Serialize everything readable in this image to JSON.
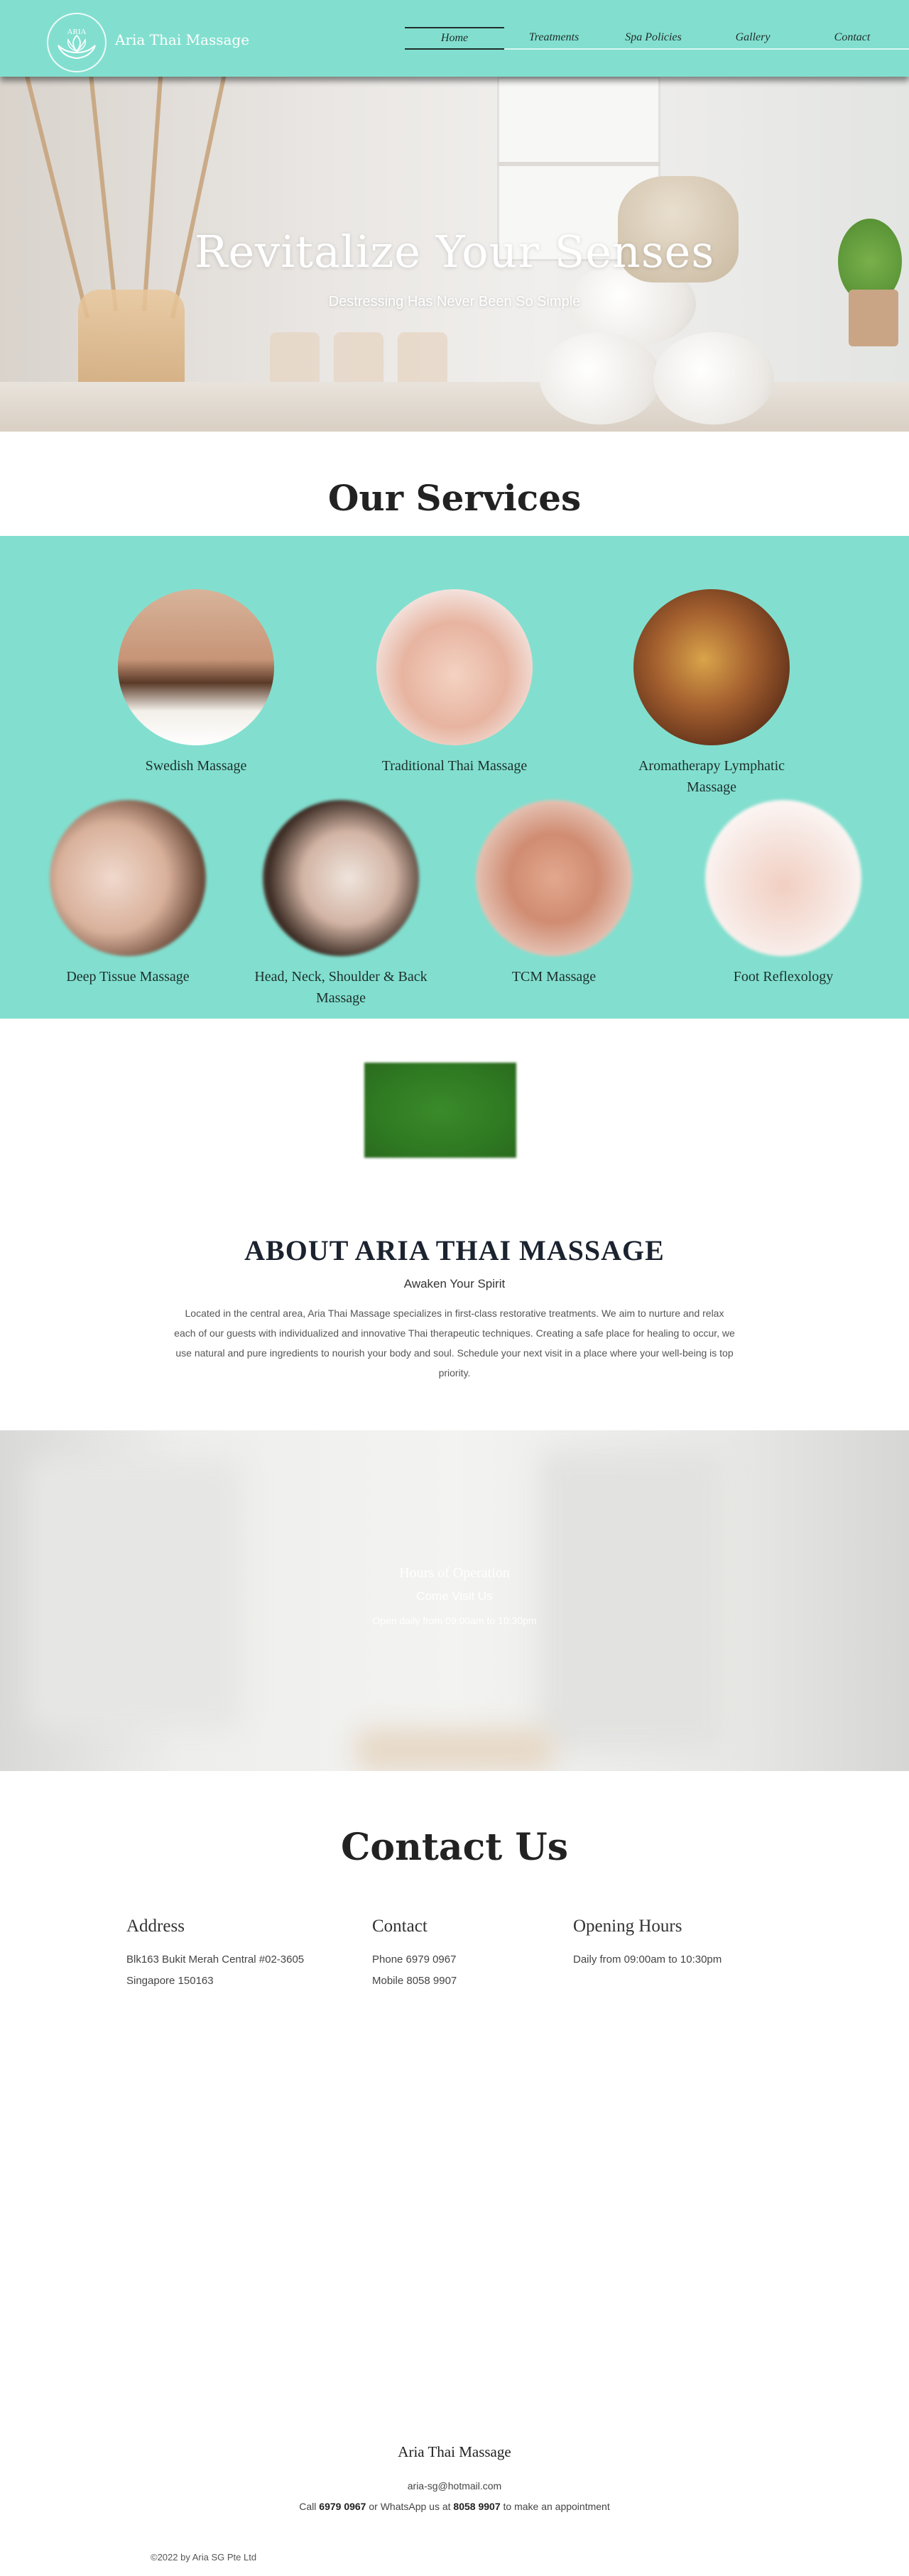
{
  "header": {
    "brand": "Aria Thai Massage",
    "logo_text": "ARIA",
    "bg_color": "#82dfcf",
    "nav": [
      {
        "label": "Home",
        "active": true
      },
      {
        "label": "Treatments",
        "active": false
      },
      {
        "label": "Spa Policies",
        "active": false
      },
      {
        "label": "Gallery",
        "active": false
      },
      {
        "label": "Contact",
        "active": false
      }
    ]
  },
  "hero": {
    "title": "Revitalize Your Senses",
    "subtitle": "Destressing Has Never Been So Simple"
  },
  "services": {
    "title": "Our Services",
    "bg_color": "#82dfcf",
    "items": [
      {
        "label": "Swedish Massage"
      },
      {
        "label": "Traditional Thai Massage"
      },
      {
        "label": "Aromatherapy Lymphatic Massage"
      },
      {
        "label": "Deep Tissue Massage"
      },
      {
        "label": "Head, Neck, Shoulder & Back Massage"
      },
      {
        "label": "TCM Massage"
      },
      {
        "label": "Foot Reflexology"
      }
    ]
  },
  "about": {
    "title": "ABOUT ARIA THAI MASSAGE",
    "subtitle": "Awaken Your Spirit",
    "text": "Located in the central area, Aria Thai Massage specializes in first-class restorative treatments. We aim to nurture and relax each of our guests with individualized and innovative Thai therapeutic techniques. Creating a safe place for healing to occur, we use natural and pure ingredients to nourish your body and soul. Schedule your next visit in a place where your well-being is top priority."
  },
  "hours": {
    "title": "Hours of Operation",
    "subtitle": "Come Visit Us",
    "text": "Open daily from 09:00am to 10:30pm"
  },
  "contact": {
    "title": "Contact Us",
    "address": {
      "heading": "Address",
      "line1": "Blk163 Bukit Merah Central #02-3605",
      "line2": "Singapore 150163"
    },
    "phone": {
      "heading": "Contact",
      "line1": "Phone 6979 0967",
      "line2": "Mobile 8058 9907"
    },
    "opening": {
      "heading": "Opening Hours",
      "line1": "Daily from 09:00am to 10:30pm"
    }
  },
  "footer": {
    "brand": "Aria Thai Massage",
    "email": "aria-sg@hotmail.com",
    "call_prefix": "Call",
    "call_phone": "6979 0967",
    "call_mid": "or WhatsApp us at",
    "call_mobile": "8058 9907",
    "call_suffix": "to make an appointment",
    "copyright": "©2022 by Aria SG Pte Ltd"
  }
}
